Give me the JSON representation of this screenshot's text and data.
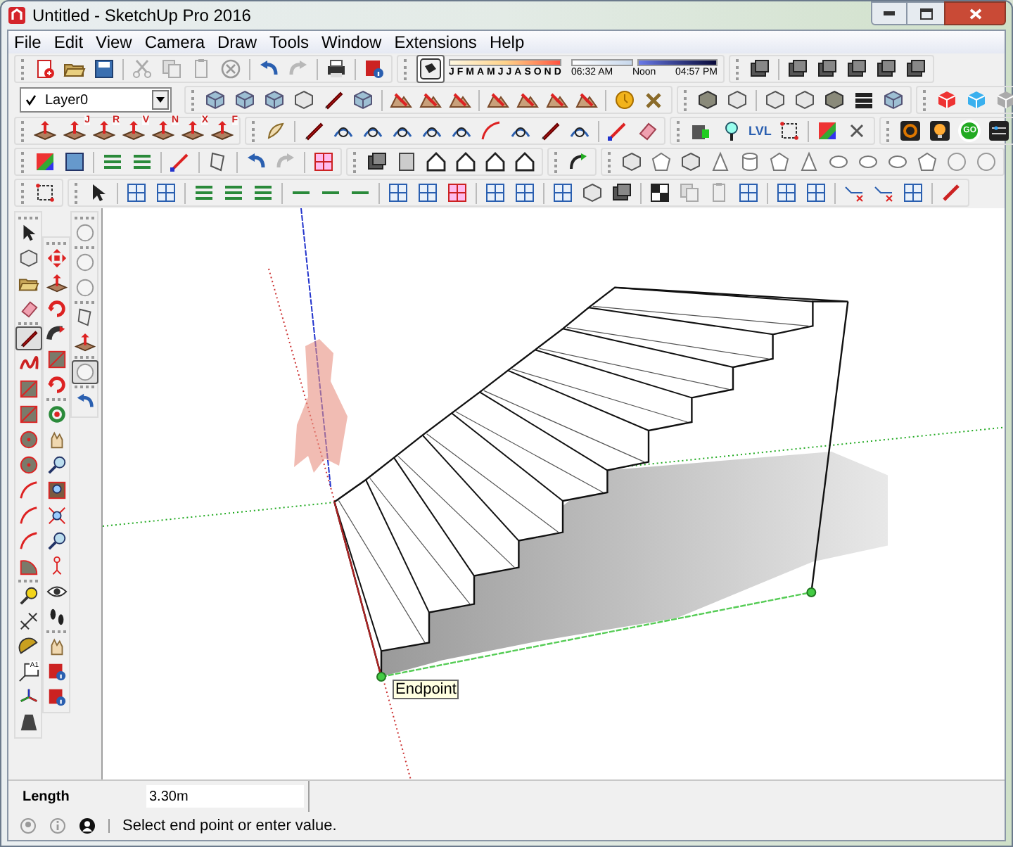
{
  "window": {
    "title": "Untitled - SketchUp Pro 2016"
  },
  "menu": [
    "File",
    "Edit",
    "View",
    "Camera",
    "Draw",
    "Tools",
    "Window",
    "Extensions",
    "Help"
  ],
  "layer": {
    "value": "Layer0",
    "checked": true
  },
  "shadow_settings": {
    "months": [
      "J",
      "F",
      "M",
      "A",
      "M",
      "J",
      "J",
      "A",
      "S",
      "O",
      "N",
      "D"
    ],
    "sunrise": "06:32 AM",
    "noon": "Noon",
    "sunset": "04:57 PM"
  },
  "push_pull_badges": [
    "J",
    "R",
    "V",
    "N",
    "X",
    "F"
  ],
  "icon_labels": {
    "level": "LVL",
    "go": "GO",
    "text_tool": "A1"
  },
  "left_toolbars": [
    {
      "tools": [
        {
          "selected": false
        },
        {
          "selected": false
        },
        {
          "selected": false
        },
        {
          "selected": false
        },
        {
          "selected": true
        },
        {
          "selected": false
        },
        {
          "selected": false
        },
        {
          "selected": false
        },
        {
          "selected": false
        },
        {
          "selected": false
        },
        {
          "selected": false
        },
        {
          "selected": false
        },
        {
          "selected": false
        },
        {
          "selected": false
        },
        {
          "selected": false
        },
        {
          "selected": false
        },
        {
          "selected": false
        },
        {
          "selected": false
        },
        {
          "selected": false
        },
        {
          "selected": false
        }
      ]
    },
    {
      "tools": [
        {
          "selected": false
        },
        {
          "selected": false
        },
        {
          "selected": false
        },
        {
          "selected": false
        },
        {
          "selected": false
        },
        {
          "selected": false
        },
        {
          "selected": false
        },
        {
          "selected": false
        },
        {
          "selected": false
        },
        {
          "selected": false
        },
        {
          "selected": false
        },
        {
          "selected": false
        },
        {
          "selected": false
        },
        {
          "selected": false
        },
        {
          "selected": false
        },
        {
          "selected": false
        },
        {
          "selected": false
        },
        {
          "selected": false
        }
      ]
    },
    {
      "tools": [
        {
          "selected": false
        },
        {
          "selected": false
        },
        {
          "selected": false
        },
        {
          "selected": false
        },
        {
          "selected": false
        },
        {
          "selected": true
        },
        {
          "selected": false
        }
      ]
    }
  ],
  "tooltip": "Endpoint",
  "measurements": {
    "label": "Length",
    "value": "3.30m"
  },
  "status_bar": {
    "message": "Select end point or enter value."
  }
}
